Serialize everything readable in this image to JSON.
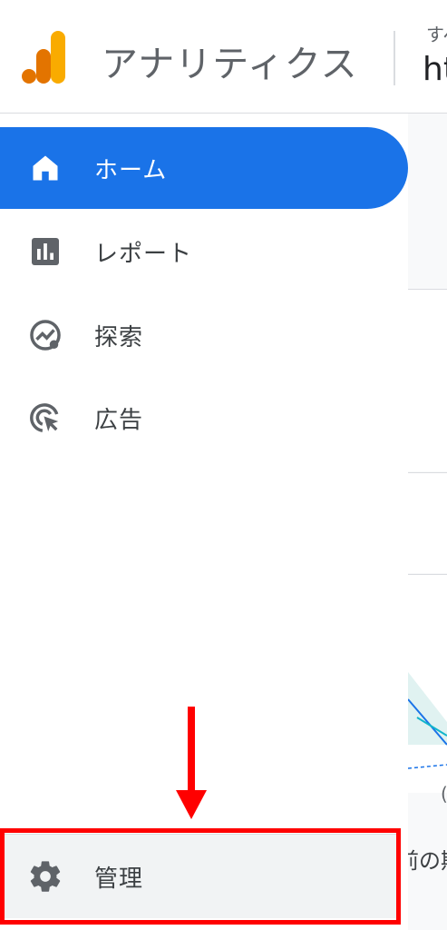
{
  "header": {
    "app_title": "アナリティクス",
    "account_sub": "すべ",
    "account_main": "ht"
  },
  "sidebar": {
    "items": [
      {
        "label": "ホーム",
        "icon": "home-icon",
        "selected": true
      },
      {
        "label": "レポート",
        "icon": "bar-chart-icon",
        "selected": false
      },
      {
        "label": "探索",
        "icon": "explore-icon",
        "selected": false
      },
      {
        "label": "広告",
        "icon": "ads-cursor-icon",
        "selected": false
      }
    ],
    "admin": {
      "label": "管理",
      "icon": "gear-icon"
    }
  },
  "content": {
    "chart_label": "(",
    "period_text": "前の期"
  },
  "colors": {
    "accent": "#1a73e8",
    "highlight": "#ff0000",
    "logo_dark": "#e37400",
    "logo_light": "#f9ab00"
  }
}
